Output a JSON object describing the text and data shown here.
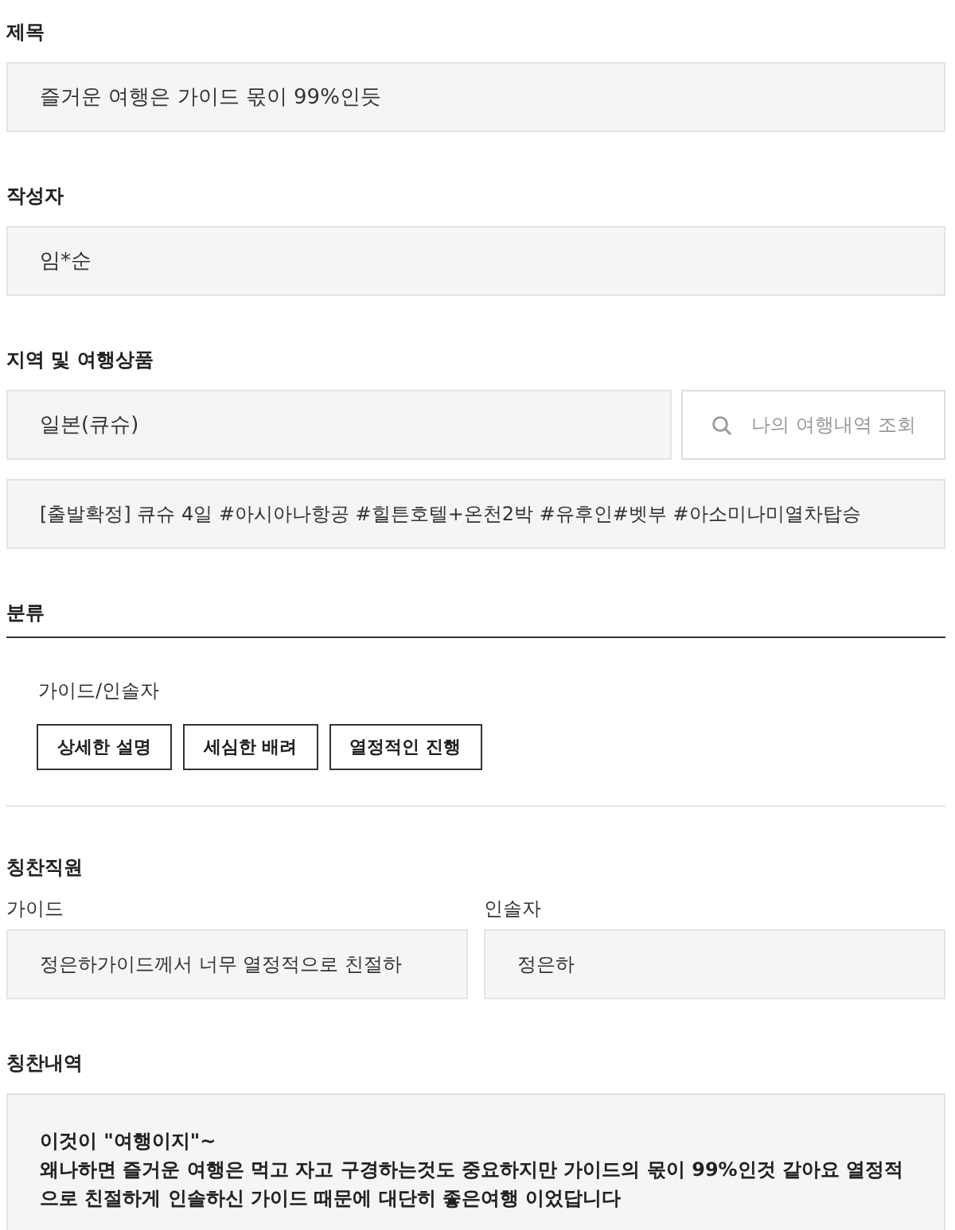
{
  "title_field": {
    "label": "제목",
    "value": "즐거운 여행은 가이드 몫이 99%인듯"
  },
  "author_field": {
    "label": "작성자",
    "value": "임*순"
  },
  "region": {
    "label": "지역 및 여행상품",
    "value": "일본(큐슈)",
    "search_button": "나의 여행내역 조회",
    "product": "[출발확정] 큐슈 4일 #아시아나항공 #힐튼호텔+온천2박 #유후인#벳부 #아소미나미열차탑승"
  },
  "category": {
    "label": "분류",
    "group": "가이드/인솔자",
    "tags": [
      "상세한 설명",
      "세심한 배려",
      "열정적인 진행"
    ]
  },
  "staff": {
    "label": "칭찬직원",
    "fields": [
      {
        "label": "가이드",
        "value": "정은하가이드께서  너무 열정적으로 친절하"
      },
      {
        "label": "인솔자",
        "value": "정은하"
      }
    ]
  },
  "praise": {
    "label": "칭찬내역",
    "lines": [
      "이것이 \"여행이지\"~",
      "왜나하면 즐거운 여행은 먹고 자고 구경하는것도 중요하지만 가이드의 몫이 99%인것 같아요 열정적으로 친절하게 인솔하신 가이드 때문에 대단히 좋은여행 이었답니다"
    ]
  }
}
